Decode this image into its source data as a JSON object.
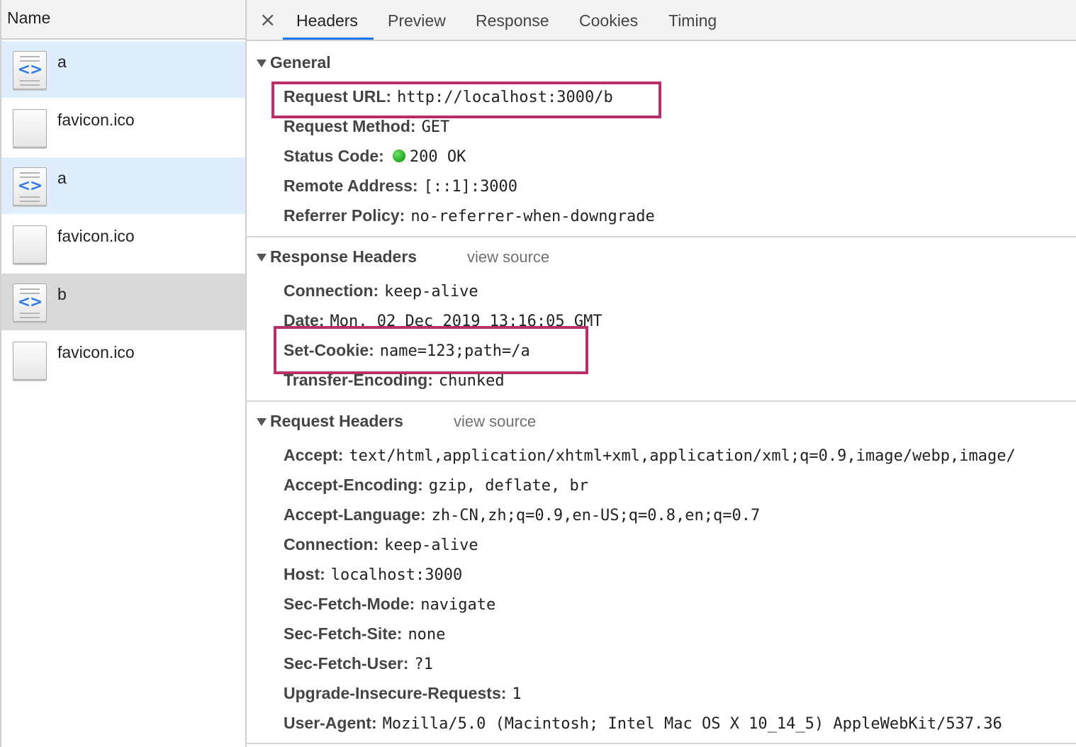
{
  "request_list": {
    "header": "Name",
    "items": [
      {
        "name": "a",
        "icon": "document-icon",
        "state": "selected-blue"
      },
      {
        "name": "favicon.ico",
        "icon": "blank-file-icon",
        "state": "normal"
      },
      {
        "name": "a",
        "icon": "document-icon",
        "state": "selected-blue"
      },
      {
        "name": "favicon.ico",
        "icon": "blank-file-icon",
        "state": "normal"
      },
      {
        "name": "b",
        "icon": "document-icon",
        "state": "selected-grey"
      },
      {
        "name": "favicon.ico",
        "icon": "blank-file-icon",
        "state": "normal"
      }
    ]
  },
  "tabs": {
    "close_symbol": "×",
    "items": [
      "Headers",
      "Preview",
      "Response",
      "Cookies",
      "Timing"
    ],
    "active": "Headers"
  },
  "general": {
    "title": "General",
    "rows": [
      {
        "key": "Request URL:",
        "value": "http://localhost:3000/b"
      },
      {
        "key": "Request Method:",
        "value": "GET"
      },
      {
        "key": "Status Code:",
        "value": "200 OK"
      },
      {
        "key": "Remote Address:",
        "value": "[::1]:3000"
      },
      {
        "key": "Referrer Policy:",
        "value": "no-referrer-when-downgrade"
      }
    ]
  },
  "response_headers": {
    "title": "Response Headers",
    "view_source": "view source",
    "rows": [
      {
        "key": "Connection:",
        "value": "keep-alive"
      },
      {
        "key": "Date:",
        "value": "Mon, 02 Dec 2019 13:16:05 GMT"
      },
      {
        "key": "Set-Cookie:",
        "value": "name=123;path=/a"
      },
      {
        "key": "Transfer-Encoding:",
        "value": "chunked"
      }
    ]
  },
  "request_headers": {
    "title": "Request Headers",
    "view_source": "view source",
    "rows": [
      {
        "key": "Accept:",
        "value": "text/html,application/xhtml+xml,application/xml;q=0.9,image/webp,image/"
      },
      {
        "key": "Accept-Encoding:",
        "value": "gzip, deflate, br"
      },
      {
        "key": "Accept-Language:",
        "value": "zh-CN,zh;q=0.9,en-US;q=0.8,en;q=0.7"
      },
      {
        "key": "Connection:",
        "value": "keep-alive"
      },
      {
        "key": "Host:",
        "value": "localhost:3000"
      },
      {
        "key": "Sec-Fetch-Mode:",
        "value": "navigate"
      },
      {
        "key": "Sec-Fetch-Site:",
        "value": "none"
      },
      {
        "key": "Sec-Fetch-User:",
        "value": "?1"
      },
      {
        "key": "Upgrade-Insecure-Requests:",
        "value": "1"
      },
      {
        "key": "User-Agent:",
        "value": "Mozilla/5.0 (Macintosh; Intel Mac OS X 10_14_5) AppleWebKit/537.36"
      }
    ]
  },
  "colors": {
    "highlight_box": "#b9306a",
    "tab_underline": "#1a73e8",
    "selected_row": "#e0edfc",
    "status_ok": "#1ea81a"
  }
}
